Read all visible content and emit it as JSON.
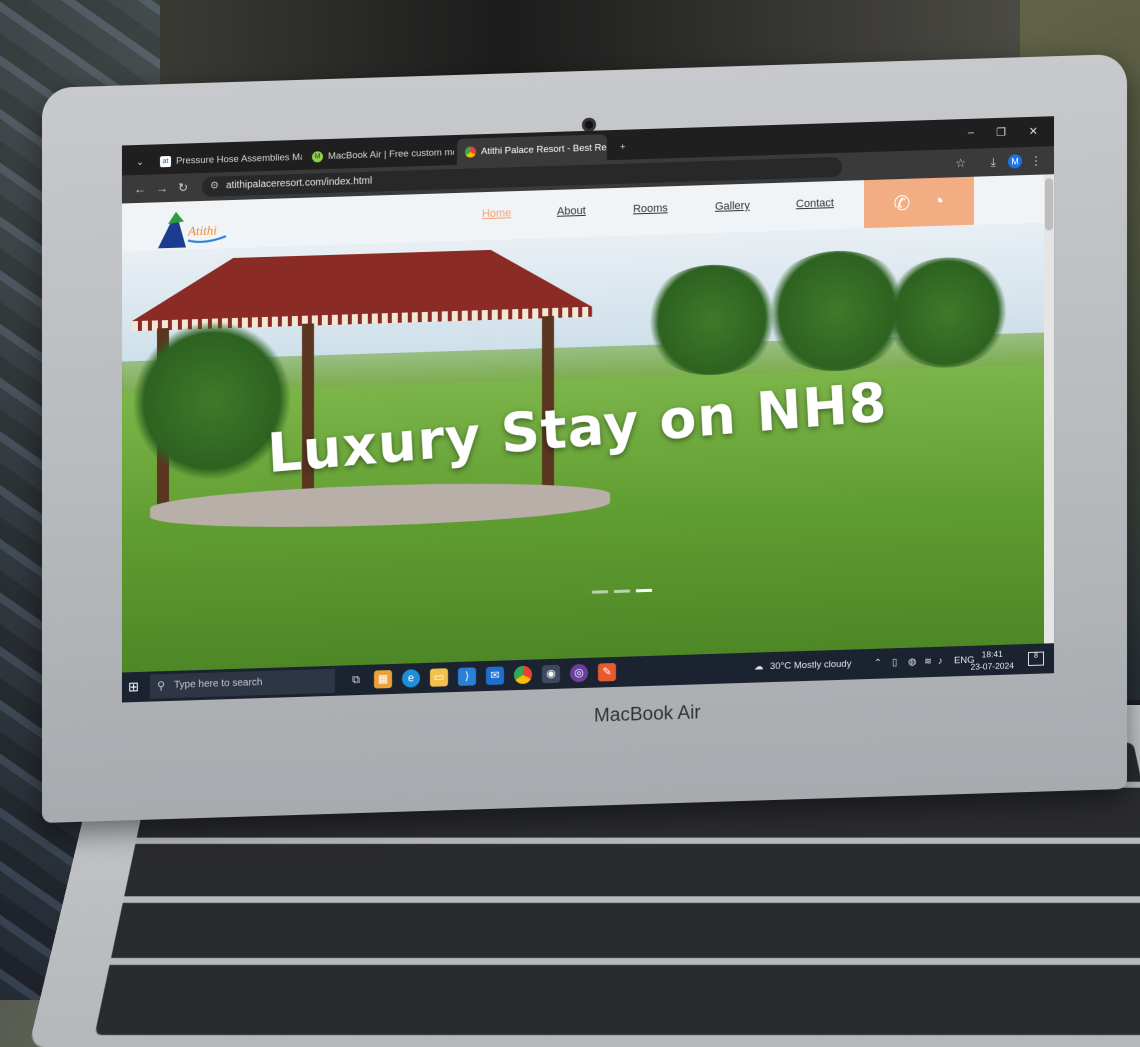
{
  "browser": {
    "tabs": [
      {
        "title": "Pressure Hose Assemblies Man",
        "favicon": "atithi-small-favicon",
        "active": false
      },
      {
        "title": "MacBook Air | Free custom mo",
        "favicon": "green-m-favicon",
        "active": false
      },
      {
        "title": "Atithi Palace Resort - Best Reso",
        "favicon": "chrome-favicon",
        "active": true
      }
    ],
    "new_tab": "+",
    "url": "atithipalaceresort.com/index.html",
    "window_controls": {
      "minimize": "–",
      "maximize": "❐",
      "close": "✕"
    }
  },
  "site": {
    "logo_text": "Atithi",
    "nav": [
      {
        "label": "Home",
        "active": true
      },
      {
        "label": "About"
      },
      {
        "label": "Rooms"
      },
      {
        "label": "Gallery"
      },
      {
        "label": "Contact"
      }
    ],
    "contact_icons": [
      "phone-icon",
      "whatsapp-icon"
    ],
    "hero_title": "Luxury Stay on NH8",
    "accent_color": "#f2ad82"
  },
  "taskbar": {
    "search_placeholder": "Type here to search",
    "weather": "30°C  Mostly cloudy",
    "language": "ENG",
    "time": "18:41",
    "date": "23-07-2024",
    "notifications": "8"
  },
  "device": {
    "brand": "MacBook Air"
  }
}
